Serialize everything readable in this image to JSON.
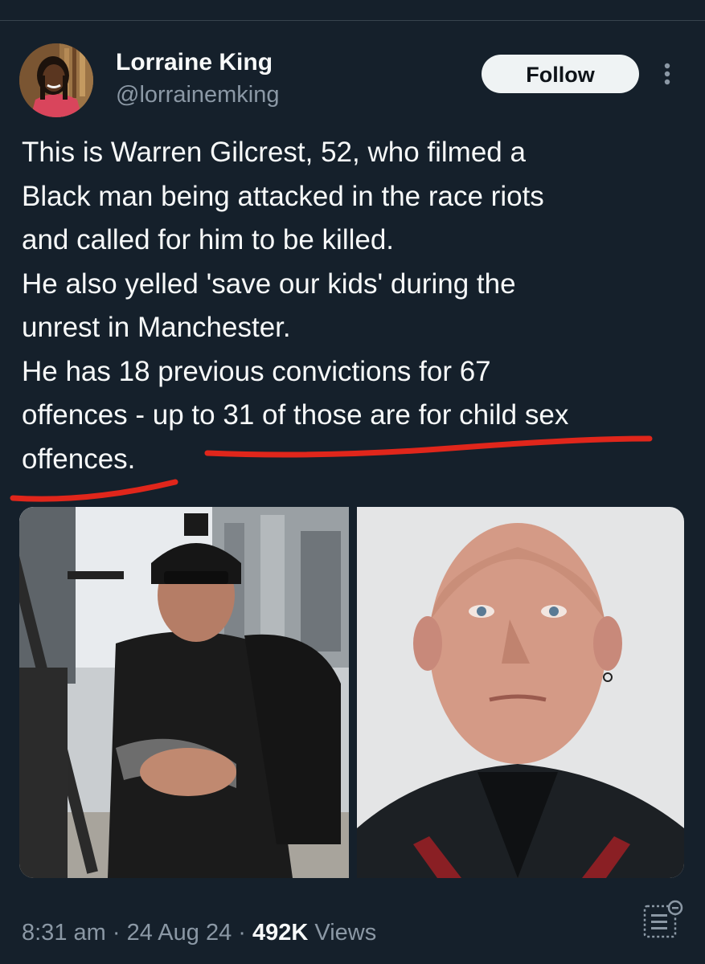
{
  "author": {
    "display_name": "Lorraine King",
    "handle": "@lorrainemking"
  },
  "actions": {
    "follow_label": "Follow",
    "more_icon": "more-vertical-icon"
  },
  "tweet": {
    "lines": [
      "This is Warren Gilcrest, 52, who filmed a",
      "Black man being attacked in the race riots",
      "and called for him to be killed.",
      "He also yelled 'save our kids' during the",
      "unrest in Manchester.",
      "He has 18 previous convictions for 67",
      "offences - up to 31 of those are for child sex",
      "offences."
    ]
  },
  "media": {
    "images": [
      "photo-protest",
      "photo-mugshot"
    ]
  },
  "meta": {
    "time": "8:31 am",
    "separator": "·",
    "date": "24 Aug 24",
    "views_count": "492K",
    "views_label": "Views"
  },
  "colors": {
    "background": "#15202b",
    "text": "#f7f9f9",
    "secondary_text": "#8b98a5",
    "annotation_red": "#e0261b",
    "follow_bg": "#eff3f4"
  }
}
